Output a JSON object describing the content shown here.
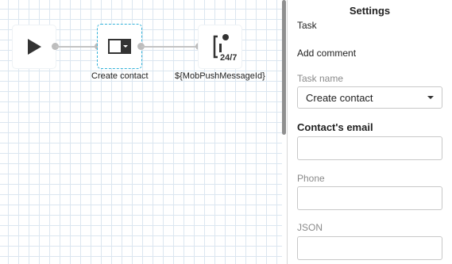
{
  "flow": {
    "nodes": [
      {
        "id": "start",
        "icon": "play-icon",
        "caption": ""
      },
      {
        "id": "create-contact",
        "icon": "form-dropdown-icon",
        "caption": "Create contact",
        "selected": true
      },
      {
        "id": "push-message",
        "icon": "info-24-7-icon",
        "badge": "24/7",
        "caption": "${MobPushMessageId}"
      }
    ]
  },
  "settings": {
    "title": "Settings",
    "section": "Task",
    "add_comment": "Add comment",
    "task_name_label": "Task name",
    "task_name_value": "Create contact",
    "email_label": "Contact's email",
    "email_value": "",
    "phone_label": "Phone",
    "phone_value": "",
    "json_label": "JSON",
    "json_value": ""
  },
  "colors": {
    "selection_border": "#35b3d9",
    "grid": "#dbe6f0"
  }
}
